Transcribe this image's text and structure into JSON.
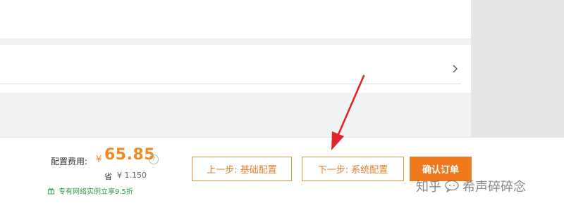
{
  "expand_row": {
    "chevron_icon": "chevron-right-icon"
  },
  "footer": {
    "price_label": "配置费用:",
    "currency_symbol": "¥",
    "price_value": "65.85",
    "help_icon_glyph": "?",
    "save_label": "省",
    "save_value": "¥ 1.150",
    "promo_icon": "gift-icon",
    "promo_text": "专有网络实例立享9.5折",
    "prev_button": "上一步: 基础配置",
    "next_button": "下一步: 系统配置",
    "confirm_button": "确认订单"
  },
  "annotation": {
    "arrow_color": "#e0242b"
  },
  "watermark": {
    "platform": "知乎",
    "handle": "希声碎碎念"
  },
  "colors": {
    "accent": "#f0791e",
    "price": "#f08a24",
    "promo": "#2d9b4b"
  }
}
